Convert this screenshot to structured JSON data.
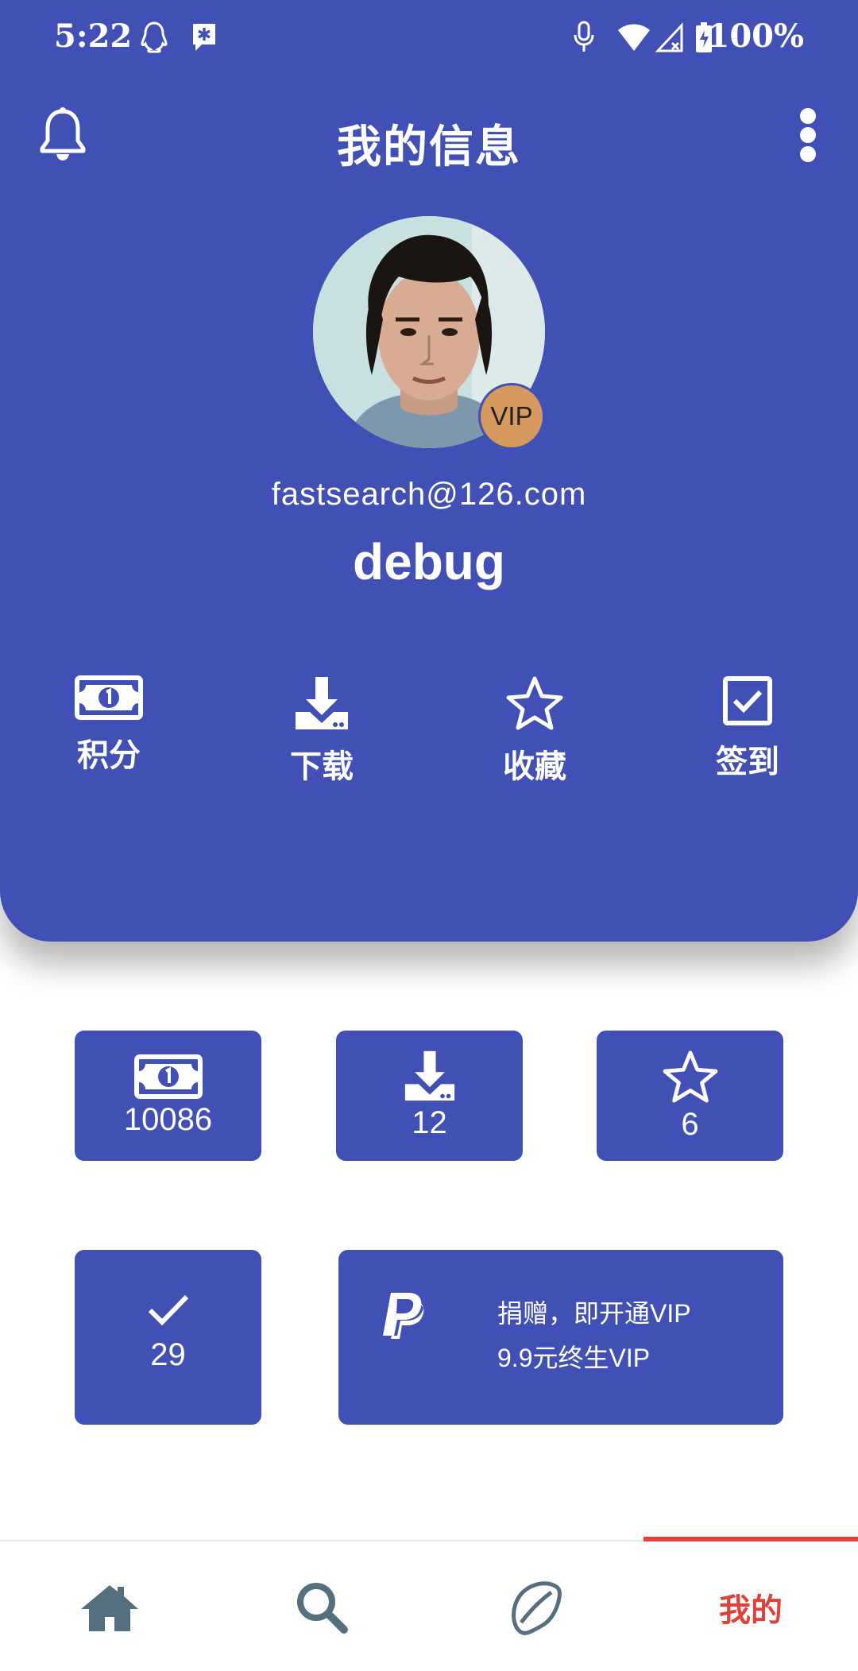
{
  "status_bar": {
    "time": "5:22",
    "battery": "100%"
  },
  "app_bar": {
    "title": "我的信息"
  },
  "profile": {
    "email": "fastsearch@126.com",
    "username": "debug",
    "badge": "VIP"
  },
  "quick_actions": [
    {
      "label": "积分",
      "icon": "money-icon"
    },
    {
      "label": "下载",
      "icon": "download-icon"
    },
    {
      "label": "收藏",
      "icon": "star-icon"
    },
    {
      "label": "签到",
      "icon": "checkbox-icon"
    }
  ],
  "stats": {
    "points": "10086",
    "downloads": "12",
    "favorites": "6",
    "checkins": "29"
  },
  "donate": {
    "line1": "捐赠，即开通VIP",
    "line2": "9.9元终生VIP",
    "icon": "paypal-icon"
  },
  "bottom_nav": {
    "active_label": "我的",
    "items": [
      "home-icon",
      "search-icon",
      "leaf-icon",
      "我的"
    ]
  },
  "colors": {
    "primary": "#4050b5",
    "accent": "#e0413a",
    "nav_icon": "#54707f",
    "badge": "#d79a5e"
  }
}
